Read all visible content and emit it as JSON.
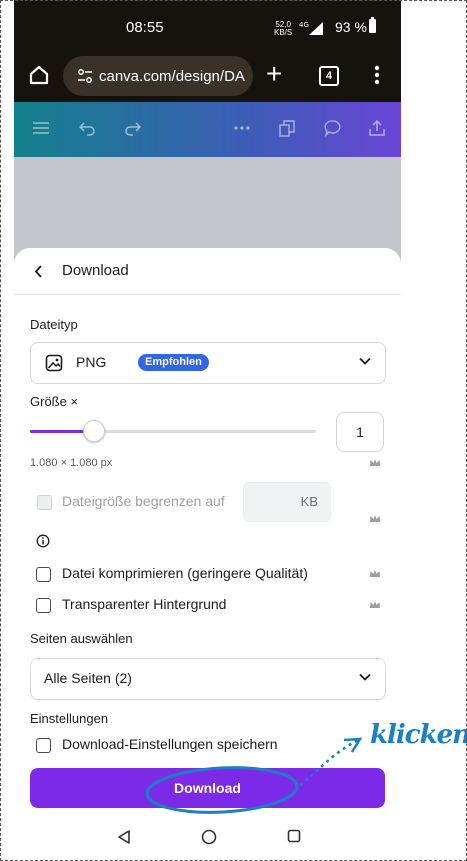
{
  "status_bar": {
    "time": "08:55",
    "net_speed_value": "52,0",
    "net_speed_unit": "KB/S",
    "network": "4G",
    "battery": "93 %"
  },
  "browser": {
    "url": "canva.com/design/DA",
    "tab_count": "4"
  },
  "sheet": {
    "title": "Download",
    "file_type_label": "Dateityp",
    "file_type_value": "PNG",
    "file_type_badge": "Empfohlen",
    "size_label": "Größe ×",
    "size_value": "1",
    "size_slider_fraction": 0.22,
    "dimensions": "1.080 × 1.080 px",
    "limit_filesize_label": "Dateigröße begrenzen auf",
    "limit_filesize_unit": "KB",
    "compress_label": "Datei komprimieren (geringere Qualität)",
    "transparent_label": "Transparenter Hintergrund",
    "pages_label": "Seiten auswählen",
    "pages_value": "Alle Seiten (2)",
    "settings_label": "Einstellungen",
    "save_settings_label": "Download-Einstellungen speichern",
    "download_button": "Download"
  },
  "annotation": {
    "text": "klicken",
    "color": "#1b7fc7"
  },
  "colors": {
    "accent": "#7d2ae8",
    "badge": "#3166e8"
  }
}
